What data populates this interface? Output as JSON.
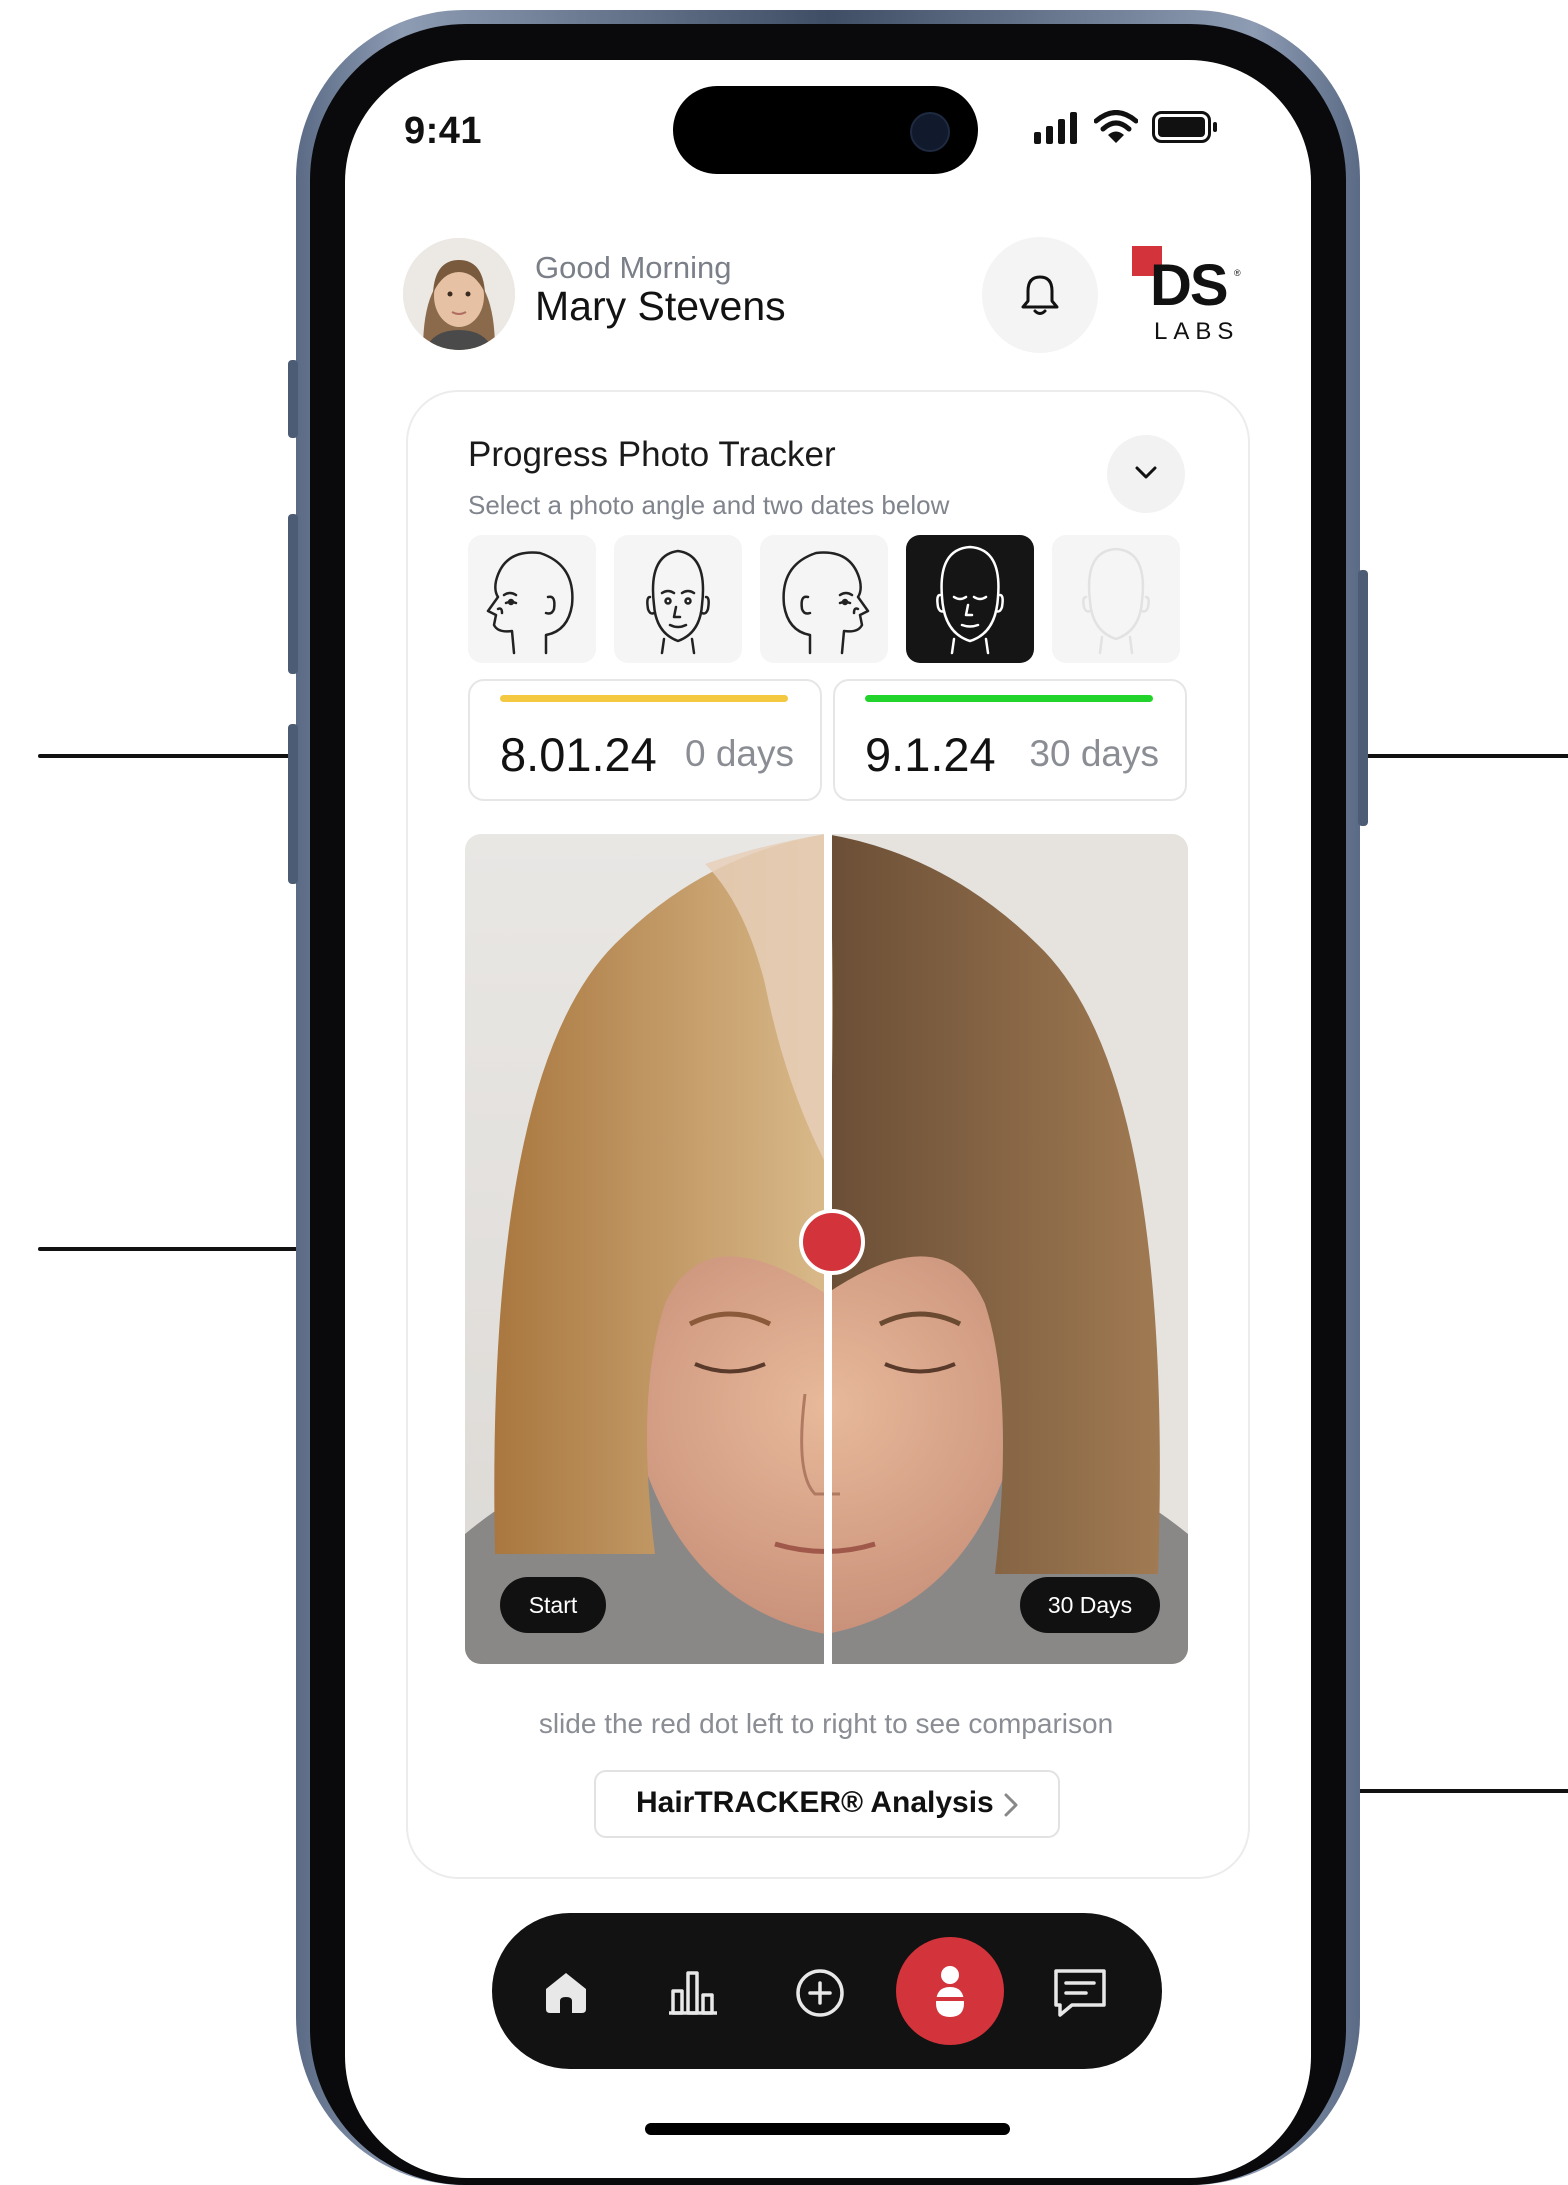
{
  "status_bar": {
    "time": "9:41"
  },
  "header": {
    "greeting": "Good Morning",
    "user_name": "Mary Stevens",
    "brand": {
      "mark": "DS",
      "sub": "LABS"
    }
  },
  "tracker": {
    "title": "Progress Photo Tracker",
    "subtitle": "Select a photo angle and two dates below",
    "angles": [
      {
        "icon": "head-left-profile-icon",
        "selected": false
      },
      {
        "icon": "head-front-icon",
        "selected": false
      },
      {
        "icon": "head-right-profile-icon",
        "selected": false
      },
      {
        "icon": "head-top-down-icon",
        "selected": true
      },
      {
        "icon": "head-back-icon",
        "selected": false
      }
    ],
    "dates": [
      {
        "date": "8.01.24",
        "days": "0 days",
        "color": "#f5c842"
      },
      {
        "date": "9.1.24",
        "days": "30 days",
        "color": "#22d32b"
      }
    ],
    "comparison": {
      "left_label": "Start",
      "right_label": "30 Days"
    },
    "hint": "slide the red dot left to right to see comparison",
    "analysis_button": "HairTRACKER® Analysis"
  },
  "tab_bar": [
    "home-icon",
    "chart-icon",
    "add-icon",
    "scan-icon",
    "message-icon"
  ],
  "colors": {
    "accent_red": "#d3333a",
    "tab_bar": "#121212",
    "frame": "#4d5c75"
  }
}
